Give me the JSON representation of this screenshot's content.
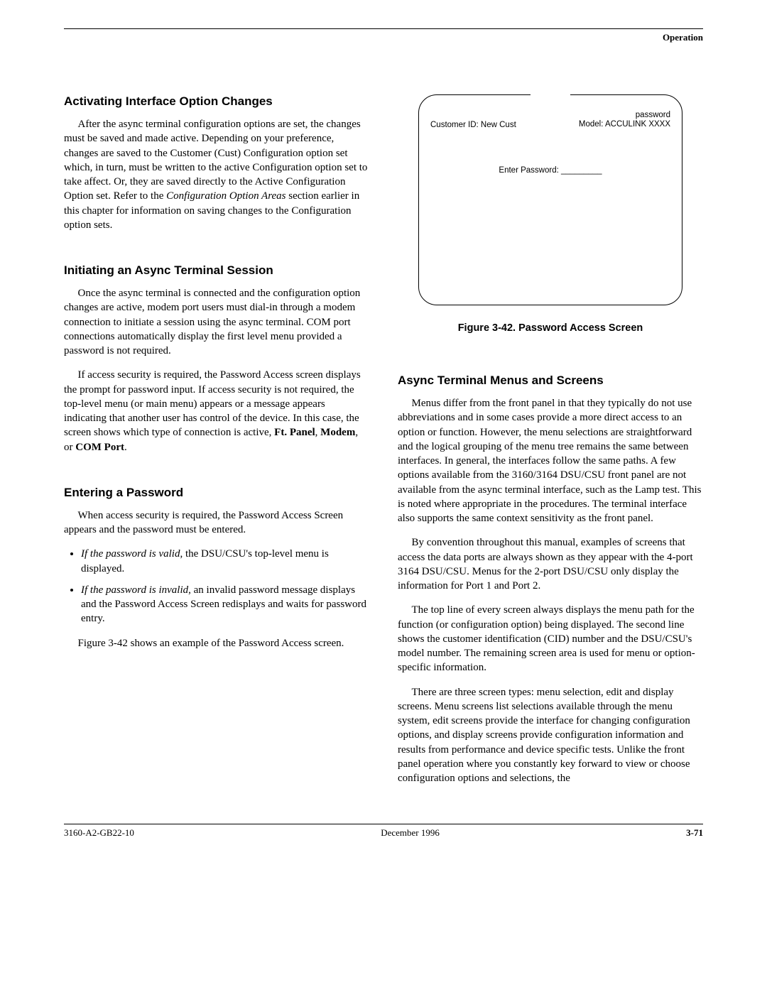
{
  "header": {
    "running_head": "Operation"
  },
  "col1": {
    "sect1_title": "Activating Interface Option Changes",
    "sect1_p1_a": "After the async terminal configuration options are set, the changes must be saved and made active. Depending on your preference, changes are saved to the Customer (Cust) Configuration option set which, in turn, must be written to the active Configuration option set to take affect. Or, they are saved directly to the Active Configuration Option set. Refer to the ",
    "sect1_p1_em": "Configuration Option Areas",
    "sect1_p1_b": " section earlier in this chapter for information on saving changes to the Configuration option sets.",
    "sect2_title": "Initiating an Async Terminal Session",
    "sect2_p1": "Once the async terminal is connected and the configuration option changes are active, modem port users must dial-in through a modem connection to initiate a session using the async terminal. COM port connections automatically display the first level menu provided a password is not required.",
    "sect2_p2_a": "If access security is required, the Password Access screen displays the prompt for password input. If access security is not required, the top-level menu (or main menu) appears or a message appears indicating that another user has control of the device. In this case, the screen shows which type of connection is active, ",
    "sect2_p2_b1": "Ft. Panel",
    "sect2_p2_sep1": ", ",
    "sect2_p2_b2": "Modem",
    "sect2_p2_sep2": ", or ",
    "sect2_p2_b3": "COM Port",
    "sect2_p2_end": ".",
    "sect3_title": "Entering a Password",
    "sect3_p1": "When access security is required, the Password Access Screen appears and the password must be entered.",
    "sect3_b1_em": "If the password is valid",
    "sect3_b1_rest": ", the DSU/CSU's top-level menu is displayed.",
    "sect3_b2_em": "If the password is invalid",
    "sect3_b2_rest": ", an invalid password message displays and the Password Access Screen redisplays and waits for password entry.",
    "sect3_p2": "Figure 3-42 shows an example of the Password Access screen."
  },
  "figure": {
    "title_small": "password",
    "customer_id": "Customer ID: New Cust",
    "model": "Model: ACCULINK XXXX",
    "enter_pw": "Enter Password: _________",
    "caption": "Figure 3-42.  Password Access Screen"
  },
  "col2": {
    "sect4_title": "Async Terminal  Menus and Screens",
    "sect4_p1": "Menus differ from the front panel in that they typically do not use abbreviations and in some cases provide a more direct access to an option or function. However, the menu selections are straightforward and the logical grouping of the menu tree remains the same between interfaces. In general, the interfaces follow the same paths. A few options available from the 3160/3164 DSU/CSU front panel are not available from the async terminal interface, such as the Lamp test. This is noted where appropriate in the procedures. The terminal interface also supports the same context sensitivity as the front panel.",
    "sect4_p2": "By convention throughout this manual, examples of screens that access the data ports are always shown as they appear with the 4-port 3164 DSU/CSU. Menus for the 2-port DSU/CSU only display the information for Port 1 and Port 2.",
    "sect4_p3": "The top line of every screen always displays the menu path for the function (or configuration option) being displayed. The second line shows the customer identification (CID) number and the DSU/CSU's model number. The remaining screen area is used for menu or option-specific information.",
    "sect4_p4": "There are three screen types: menu selection, edit and display screens. Menu screens list selections available through the menu system, edit screens provide the interface for changing configuration options, and display screens provide configuration information and results from performance and device specific tests. Unlike the front panel operation where you constantly key forward to view or choose configuration options and selections, the"
  },
  "footer": {
    "left": "3160-A2-GB22-10",
    "center": "December 1996",
    "right": "3-71"
  }
}
